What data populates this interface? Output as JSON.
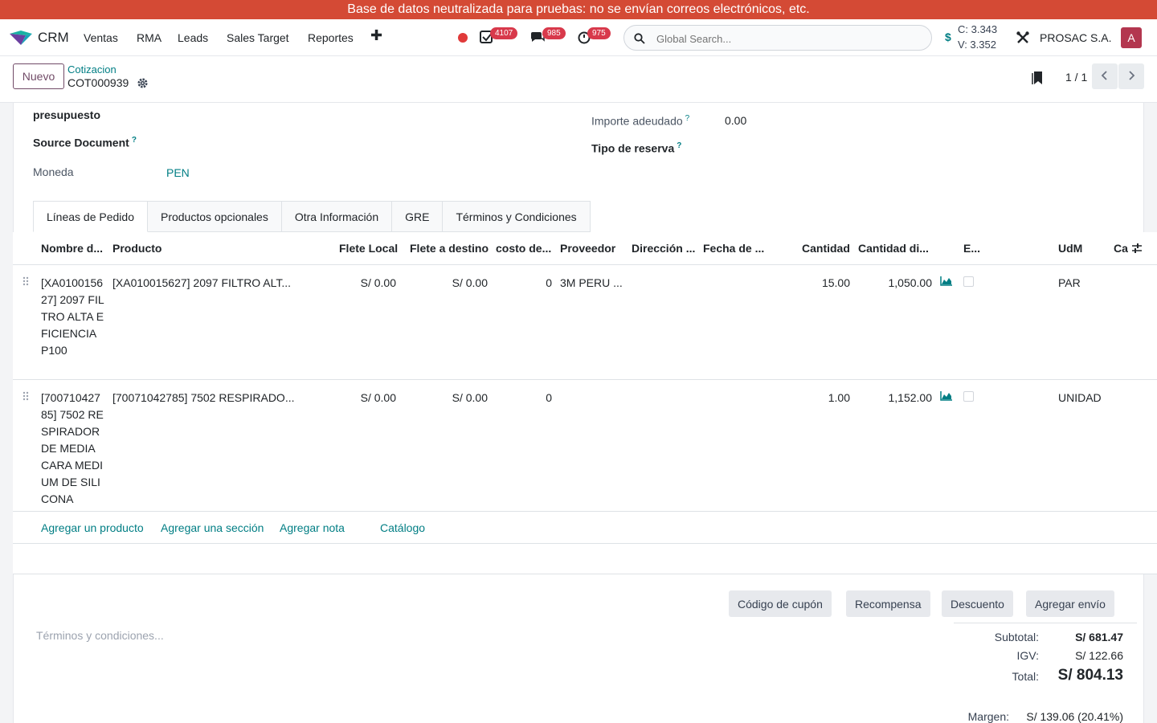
{
  "banner": "Base de datos neutralizada para pruebas: no se envían correos electrónicos, etc.",
  "nav": {
    "app_name": "CRM",
    "menu": [
      "Ventas",
      "RMA",
      "Leads",
      "Sales Target",
      "Reportes"
    ],
    "badges": {
      "activities": "4107",
      "messages": "985",
      "timers": "975"
    },
    "search_placeholder": "Global Search...",
    "currency_symbol": "$",
    "rate_buy": "C: 3.343",
    "rate_sell": "V: 3.352",
    "company": "PROSAC S.A.",
    "avatar_letter": "A"
  },
  "control": {
    "new_label": "Nuevo",
    "breadcrumb": "Cotizacion",
    "record": "COT000939",
    "pager": "1 / 1"
  },
  "form": {
    "presupuesto_label": "presupuesto",
    "source_label": "Source Document",
    "moneda_label": "Moneda",
    "moneda_value": "PEN",
    "importe_label": "Importe adeudado",
    "importe_value": "0.00",
    "reserva_label": "Tipo de reserva",
    "help_mark": "?"
  },
  "tabs": [
    "Líneas de Pedido",
    "Productos opcionales",
    "Otra Información",
    "GRE",
    "Términos y Condiciones"
  ],
  "table": {
    "columns": [
      "Nombre d...",
      "Producto",
      "Flete Local",
      "Flete a destino",
      "costo de...",
      "Proveedor",
      "Dirección ...",
      "Fecha de ...",
      "Cantidad",
      "Cantidad di...",
      "E...",
      "UdM",
      "Ca"
    ],
    "rows": [
      {
        "name": "[XA010015627] 2097 FILTRO ALTA EFICIENCIA P100",
        "product": "[XA010015627] 2097 FILTRO ALT...",
        "flete_local": "S/ 0.00",
        "flete_destino": "S/ 0.00",
        "costo": "0",
        "proveedor": "3M PERU ...",
        "cantidad": "15.00",
        "cantidad_disp": "1,050.00",
        "udm": "PAR"
      },
      {
        "name": "[70071042785] 7502 RESPIRADOR DE MEDIA CARA MEDIUM DE SILICONA",
        "product": "[70071042785] 7502 RESPIRADO...",
        "flete_local": "S/ 0.00",
        "flete_destino": "S/ 0.00",
        "costo": "0",
        "proveedor": "",
        "cantidad": "1.00",
        "cantidad_disp": "1,152.00",
        "udm": "UNIDAD"
      }
    ],
    "add_links": [
      "Agregar un producto",
      "Agregar una sección",
      "Agregar nota",
      "Catálogo"
    ]
  },
  "footer": {
    "buttons": [
      "Código de cupón",
      "Recompensa",
      "Descuento",
      "Agregar envío"
    ],
    "terms_placeholder": "Términos y condiciones...",
    "subtotal_label": "Subtotal:",
    "subtotal_value": "S/ 681.47",
    "igv_label": "IGV:",
    "igv_value": "S/ 122.66",
    "total_label": "Total:",
    "total_value": "S/ 804.13",
    "margin_label": "Margen:",
    "margin_value": "S/ 139.06 (20.41%)"
  },
  "colors": {
    "banner": "#d44a35",
    "accent": "#017e84",
    "brand": "#714b67",
    "badge": "#d8394b"
  }
}
